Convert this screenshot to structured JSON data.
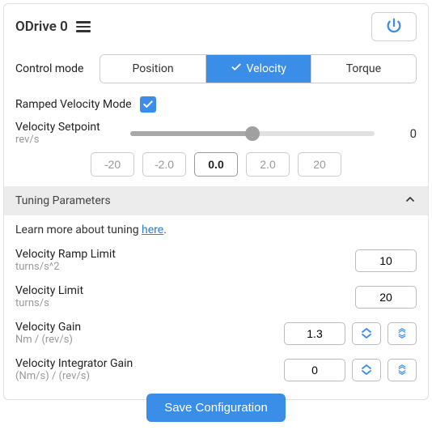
{
  "header": {
    "title": "ODrive 0"
  },
  "control_mode": {
    "label": "Control mode",
    "options": [
      "Position",
      "Velocity",
      "Torque"
    ],
    "active_index": 1
  },
  "ramped": {
    "label": "Ramped Velocity Mode",
    "checked": true
  },
  "setpoint": {
    "label": "Velocity Setpoint",
    "unit": "rev/s",
    "value": "0",
    "presets": [
      "-20",
      "-2.0",
      "0.0",
      "2.0",
      "20"
    ],
    "active_preset_index": 2
  },
  "tuning": {
    "section_title": "Tuning Parameters",
    "learn_prefix": "Learn more about tuning ",
    "learn_link": "here",
    "learn_suffix": ".",
    "params": [
      {
        "label": "Velocity Ramp Limit",
        "unit": "turns/s^2",
        "value": "10",
        "spinners": false
      },
      {
        "label": "Velocity Limit",
        "unit": "turns/s",
        "value": "20",
        "spinners": false
      },
      {
        "label": "Velocity Gain",
        "unit": "Nm / (rev/s)",
        "value": "1.3",
        "spinners": true
      },
      {
        "label": "Velocity Integrator Gain",
        "unit": "(Nm/s) / (rev/s)",
        "value": "0",
        "spinners": true
      }
    ],
    "save_label": "Save Configuration"
  },
  "colors": {
    "accent": "#3b8ee8"
  }
}
